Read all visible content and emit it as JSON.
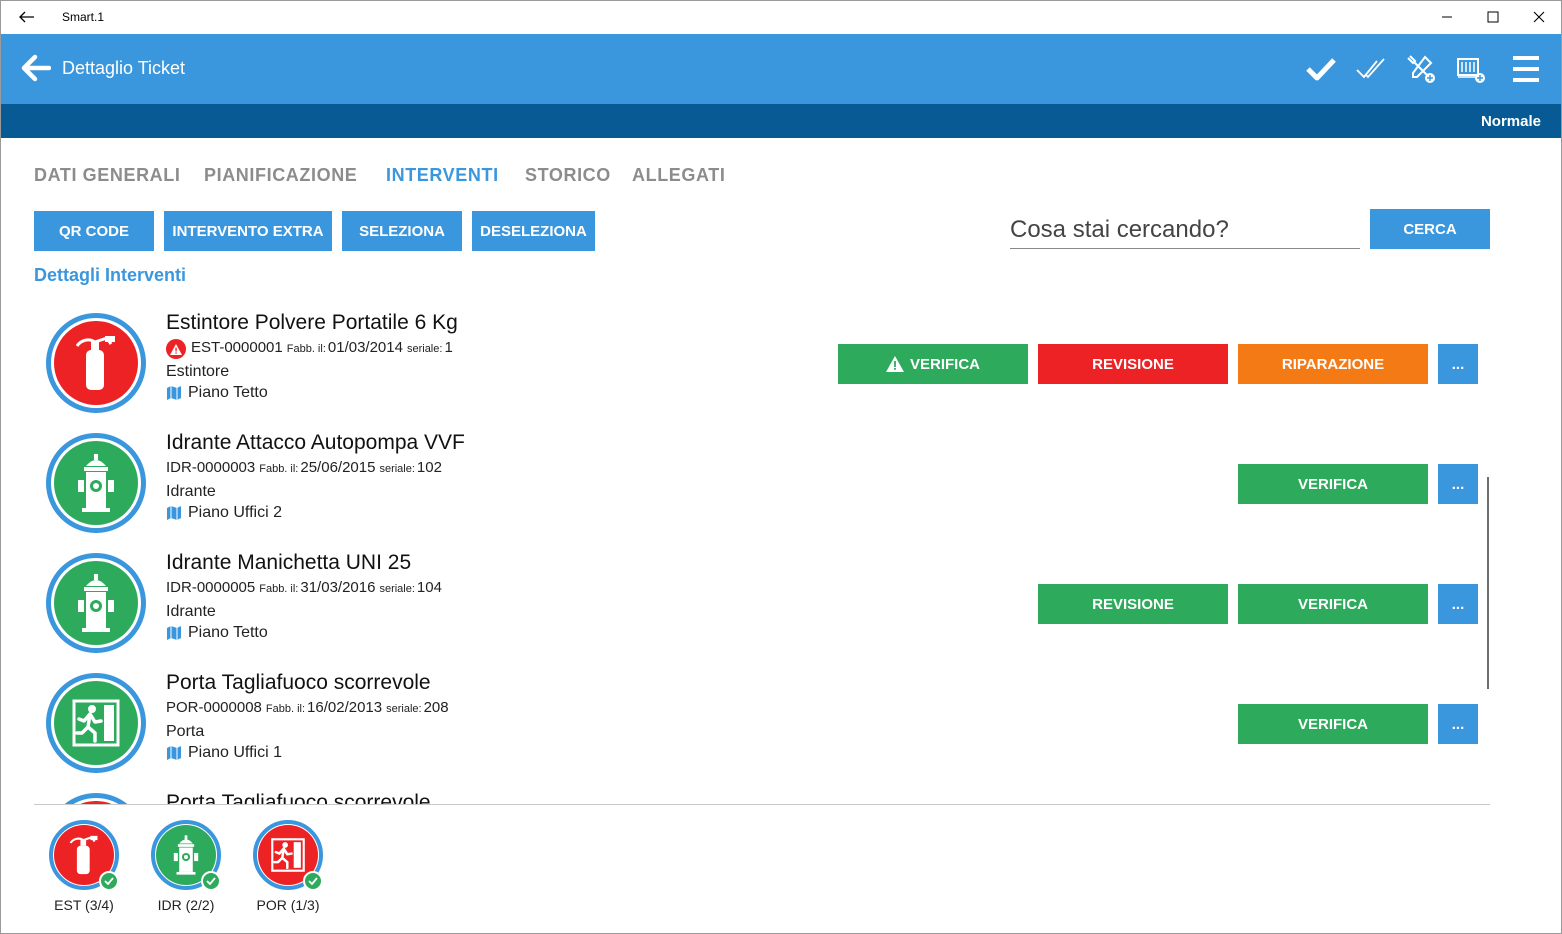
{
  "window": {
    "title": "Smart.1"
  },
  "header": {
    "title": "Dettaglio Ticket",
    "icons": [
      "check-icon",
      "double-check-icon",
      "tools-add-icon",
      "equipment-add-icon",
      "menu-icon"
    ]
  },
  "status": {
    "priority": "Normale"
  },
  "tabs": [
    {
      "label": "DATI GENERALI"
    },
    {
      "label": "PIANIFICAZIONE"
    },
    {
      "label": "INTERVENTI"
    },
    {
      "label": "STORICO"
    },
    {
      "label": "ALLEGATI"
    }
  ],
  "toolbar": {
    "qr_code": "QR CODE",
    "intervento_extra": "INTERVENTO EXTRA",
    "seleziona": "SELEZIONA",
    "deseleziona": "DESELEZIONA",
    "search_placeholder": "Cosa stai cercando?",
    "search_button": "CERCA"
  },
  "section": {
    "title": "Dettagli Interventi"
  },
  "items": [
    {
      "name": "Estintore Polvere Portatile 6 Kg",
      "code": "EST-0000001",
      "fabb_label": "Fabb. il:",
      "fabb_date": "01/03/2014",
      "serial_label": "seriale:",
      "serial": "1",
      "type": "Estintore",
      "location": "Piano Tetto",
      "icon": "fire-extinguisher-icon",
      "actions": [
        "VERIFICA",
        "REVISIONE",
        "RIPARAZIONE",
        "..."
      ]
    },
    {
      "name": "Idrante Attacco Autopompa VVF",
      "code": "IDR-0000003",
      "fabb_label": "Fabb. il:",
      "fabb_date": "25/06/2015",
      "serial_label": "seriale:",
      "serial": "102",
      "type": "Idrante",
      "location": "Piano Uffici 2",
      "icon": "hydrant-icon",
      "actions": [
        "VERIFICA",
        "..."
      ]
    },
    {
      "name": "Idrante Manichetta UNI 25",
      "code": "IDR-0000005",
      "fabb_label": "Fabb. il:",
      "fabb_date": "31/03/2016",
      "serial_label": "seriale:",
      "serial": "104",
      "type": "Idrante",
      "location": "Piano Tetto",
      "icon": "hydrant-icon",
      "actions": [
        "REVISIONE",
        "VERIFICA",
        "..."
      ]
    },
    {
      "name": "Porta Tagliafuoco scorrevole",
      "code": "POR-0000008",
      "fabb_label": "Fabb. il:",
      "fabb_date": "16/02/2013",
      "serial_label": "seriale:",
      "serial": "208",
      "type": "Porta",
      "location": "Piano Uffici 1",
      "icon": "emergency-exit-icon",
      "actions": [
        "VERIFICA",
        "..."
      ]
    },
    {
      "name": "Porta Tagliafuoco scorrevole",
      "icon": "emergency-exit-icon"
    }
  ],
  "summary": [
    {
      "label": "EST (3/4)",
      "icon": "fire-extinguisher-icon",
      "color": "#ed2224"
    },
    {
      "label": "IDR (2/2)",
      "icon": "hydrant-icon",
      "color": "#2eaa5c"
    },
    {
      "label": "POR (1/3)",
      "icon": "emergency-exit-icon",
      "color": "#ed2224"
    }
  ],
  "colors": {
    "accent": "#3b97dd",
    "dark_bar": "#085a94",
    "green": "#2eaa5c",
    "red": "#ed2224",
    "orange": "#f47a16"
  }
}
